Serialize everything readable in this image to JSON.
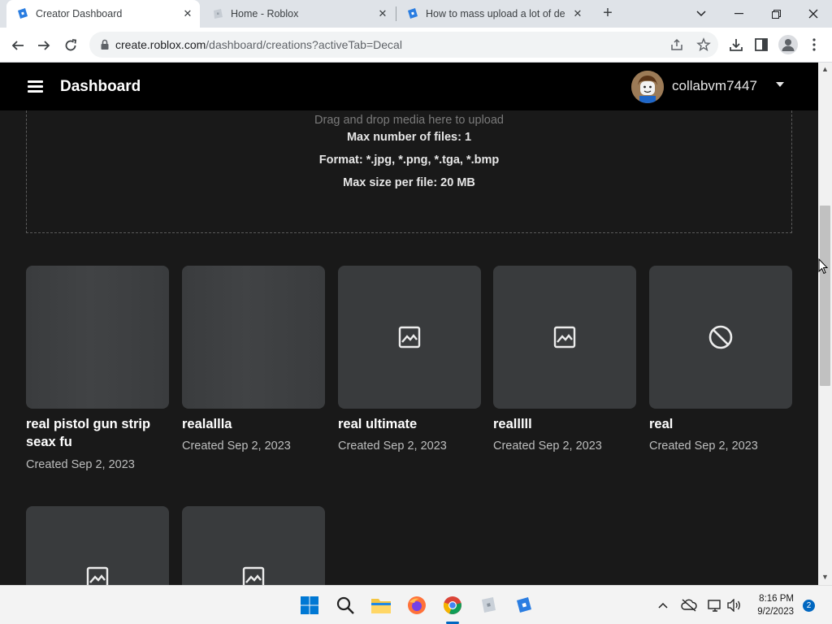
{
  "browser": {
    "tabs": [
      {
        "title": "Creator Dashboard",
        "favicon": "roblox-studio-icon"
      },
      {
        "title": "Home - Roblox",
        "favicon": "roblox-icon"
      },
      {
        "title": "How to mass upload a lot of dec",
        "favicon": "roblox-studio-icon"
      }
    ],
    "url_host": "create.roblox.com",
    "url_path": "/dashboard/creations?activeTab=Decal"
  },
  "header": {
    "title": "Dashboard",
    "username": "collabvm7447"
  },
  "dropzone": {
    "hint": "Drag and drop media here to upload",
    "max_files": "Max number of files: 1",
    "formats": "Format: *.jpg, *.png, *.tga, *.bmp",
    "max_size": "Max size per file: 20 MB"
  },
  "creations": [
    {
      "name": "real pistol gun strip seax fu",
      "created": "Created Sep 2, 2023",
      "thumb": "blank"
    },
    {
      "name": "realallla",
      "created": "Created Sep 2, 2023",
      "thumb": "blank"
    },
    {
      "name": "real ultimate",
      "created": "Created Sep 2, 2023",
      "thumb": "image-placeholder-icon"
    },
    {
      "name": "realllll",
      "created": "Created Sep 2, 2023",
      "thumb": "image-placeholder-icon"
    },
    {
      "name": "real",
      "created": "Created Sep 2, 2023",
      "thumb": "blocked-icon"
    },
    {
      "name": "",
      "created": "",
      "thumb": "image-placeholder-icon"
    },
    {
      "name": "",
      "created": "",
      "thumb": "image-placeholder-icon"
    }
  ],
  "taskbar": {
    "time": "8:16 PM",
    "date": "9/2/2023",
    "notification_count": "2"
  },
  "colors": {
    "page_bg": "#191919",
    "header_bg": "#000000",
    "card_bg": "#393b3d",
    "accent": "#0067c0"
  }
}
